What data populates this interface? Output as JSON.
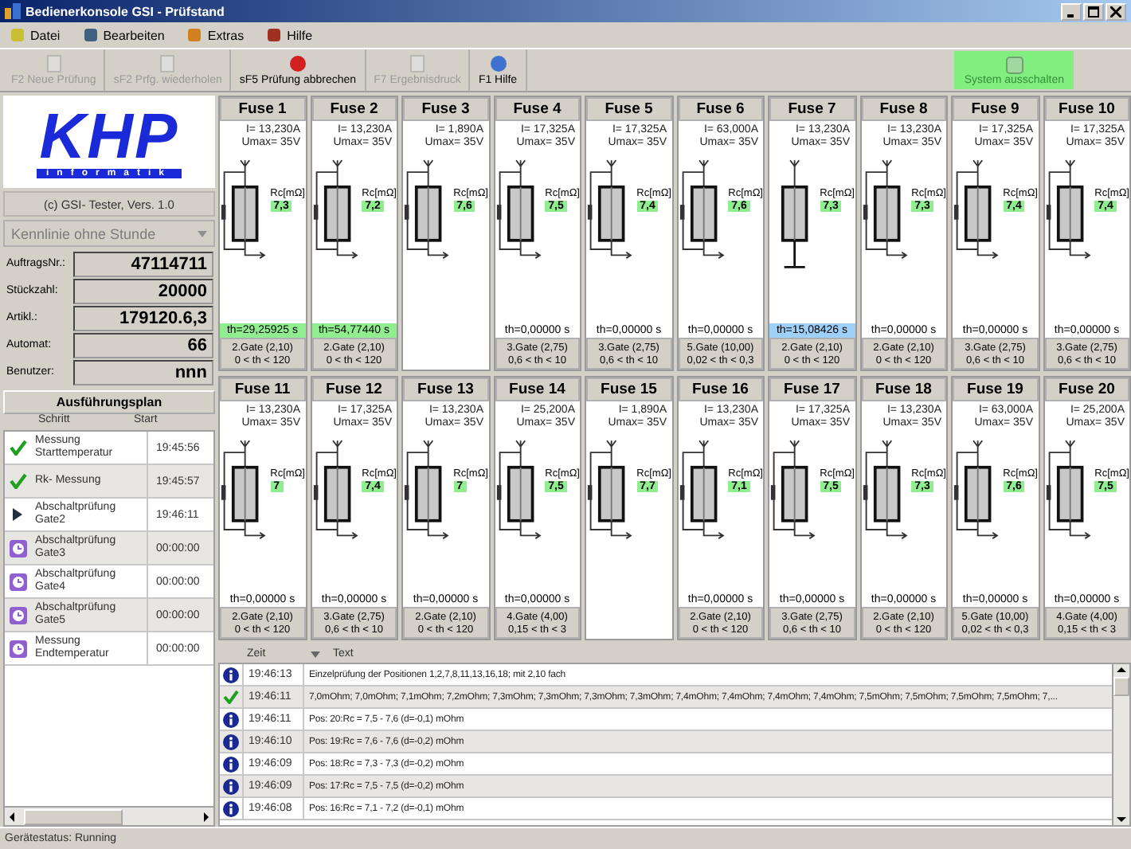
{
  "window": {
    "title": "Bedienerkonsole GSI - Prüfstand"
  },
  "menu": [
    {
      "label": "Datei"
    },
    {
      "label": "Bearbeiten"
    },
    {
      "label": "Extras"
    },
    {
      "label": "Hilfe"
    }
  ],
  "toolbar": [
    {
      "label": "F2 Neue Prüfung",
      "disabled": true
    },
    {
      "label": "sF2 Prfg. wiederholen",
      "disabled": true
    },
    {
      "label": "sF5 Prüfung abbrechen",
      "disabled": false
    },
    {
      "label": "F7 Ergebnisdruck",
      "disabled": true
    },
    {
      "label": "F1 Hilfe",
      "disabled": false
    }
  ],
  "power_button": {
    "label": "System ausschalten"
  },
  "logo": {
    "text": "KHP",
    "subtitle": "informatik"
  },
  "version": "(c) GSI- Tester, Vers. 1.0",
  "curve_select": {
    "value": "Kennlinie ohne Stunde",
    "disabled": true
  },
  "fields": [
    {
      "label": "AuftragsNr.:",
      "value": "47114711"
    },
    {
      "label": "Stückzahl:",
      "value": "20000"
    },
    {
      "label": "Artikl.:",
      "value": "179120.6,3"
    },
    {
      "label": "Automat:",
      "value": "66"
    },
    {
      "label": "Benutzer:",
      "value": "nnn"
    }
  ],
  "plan": {
    "title": "Ausführungsplan",
    "columns": [
      "Schritt",
      "Start"
    ],
    "steps": [
      {
        "kind": "done",
        "step": "Messung Starttemperatur",
        "start": "19:45:56"
      },
      {
        "kind": "done",
        "step": "Rk- Messung",
        "start": "19:45:57"
      },
      {
        "kind": "running",
        "step": "Abschaltprüfung Gate2",
        "start": "19:46:11"
      },
      {
        "kind": "pending",
        "step": "Abschaltprüfung Gate3",
        "start": "00:00:00"
      },
      {
        "kind": "pending",
        "step": "Abschaltprüfung Gate4",
        "start": "00:00:00"
      },
      {
        "kind": "pending",
        "step": "Abschaltprüfung Gate5",
        "start": "00:00:00"
      },
      {
        "kind": "pending",
        "step": "Messung Endtemperatur",
        "start": "00:00:00"
      }
    ]
  },
  "fuses": [
    {
      "name": "Fuse 1",
      "current": "I= 13,230A",
      "umax": "Umax= 35V",
      "kind": "bypass",
      "rc_label": "Rc[mΩ]",
      "rc": "7,3",
      "th": "th=29,25925 s",
      "passed": true,
      "running": false,
      "gate": [
        "2.Gate (2,10)",
        "0 < th < 120"
      ]
    },
    {
      "name": "Fuse 2",
      "current": "I= 13,230A",
      "umax": "Umax= 35V",
      "kind": "bypass",
      "rc_label": "Rc[mΩ]",
      "rc": "7,2",
      "th": "th=54,77440 s",
      "passed": true,
      "running": false,
      "gate": [
        "2.Gate (2,10)",
        "0 < th < 120"
      ]
    },
    {
      "name": "Fuse 3",
      "current": "I= 1,890A",
      "umax": "Umax= 35V",
      "kind": "bypass",
      "rc_label": "Rc[mΩ]",
      "rc": "7,6"
    },
    {
      "name": "Fuse 4",
      "current": "I= 17,325A",
      "umax": "Umax= 35V",
      "kind": "bypass",
      "rc_label": "Rc[mΩ]",
      "rc": "7,5",
      "th": "th=0,00000 s",
      "passed": false,
      "running": false,
      "gate": [
        "3.Gate (2,75)",
        "0,6 < th < 10"
      ]
    },
    {
      "name": "Fuse 5",
      "current": "I= 17,325A",
      "umax": "Umax= 35V",
      "kind": "bypass",
      "rc_label": "Rc[mΩ]",
      "rc": "7,4",
      "th": "th=0,00000 s",
      "passed": false,
      "running": false,
      "gate": [
        "3.Gate (2,75)",
        "0,6 < th < 10"
      ]
    },
    {
      "name": "Fuse 6",
      "current": "I= 63,000A",
      "umax": "Umax= 35V",
      "kind": "bypass",
      "rc_label": "Rc[mΩ]",
      "rc": "7,6",
      "th": "th=0,00000 s",
      "passed": false,
      "running": false,
      "gate": [
        "5.Gate (10,00)",
        "0,02 < th < 0,3"
      ]
    },
    {
      "name": "Fuse 7",
      "current": "I= 13,230A",
      "umax": "Umax= 35V",
      "kind": "ground",
      "rc_label": "Rc[mΩ]",
      "rc": "7,3",
      "th": "th=15,08426 s",
      "passed": false,
      "running": true,
      "gate": [
        "2.Gate (2,10)",
        "0 < th < 120"
      ]
    },
    {
      "name": "Fuse 8",
      "current": "I= 13,230A",
      "umax": "Umax= 35V",
      "kind": "bypass",
      "rc_label": "Rc[mΩ]",
      "rc": "7,3",
      "th": "th=0,00000 s",
      "passed": false,
      "running": false,
      "gate": [
        "2.Gate (2,10)",
        "0 < th < 120"
      ]
    },
    {
      "name": "Fuse 9",
      "current": "I= 17,325A",
      "umax": "Umax= 35V",
      "kind": "bypass",
      "rc_label": "Rc[mΩ]",
      "rc": "7,4",
      "th": "th=0,00000 s",
      "passed": false,
      "running": false,
      "gate": [
        "3.Gate (2,75)",
        "0,6 < th < 10"
      ]
    },
    {
      "name": "Fuse 10",
      "current": "I= 17,325A",
      "umax": "Umax= 35V",
      "kind": "bypass",
      "rc_label": "Rc[mΩ]",
      "rc": "7,4",
      "th": "th=0,00000 s",
      "passed": false,
      "running": false,
      "gate": [
        "3.Gate (2,75)",
        "0,6 < th < 10"
      ]
    },
    {
      "name": "Fuse 11",
      "current": "I= 13,230A",
      "umax": "Umax= 35V",
      "kind": "bypass",
      "rc_label": "Rc[mΩ]",
      "rc": "7",
      "th": "th=0,00000 s",
      "passed": false,
      "running": false,
      "gate": [
        "2.Gate (2,10)",
        "0 < th < 120"
      ]
    },
    {
      "name": "Fuse 12",
      "current": "I= 17,325A",
      "umax": "Umax= 35V",
      "kind": "bypass",
      "rc_label": "Rc[mΩ]",
      "rc": "7,4",
      "th": "th=0,00000 s",
      "passed": false,
      "running": false,
      "gate": [
        "3.Gate (2,75)",
        "0,6 < th < 10"
      ]
    },
    {
      "name": "Fuse 13",
      "current": "I= 13,230A",
      "umax": "Umax= 35V",
      "kind": "bypass",
      "rc_label": "Rc[mΩ]",
      "rc": "7",
      "th": "th=0,00000 s",
      "passed": false,
      "running": false,
      "gate": [
        "2.Gate (2,10)",
        "0 < th < 120"
      ]
    },
    {
      "name": "Fuse 14",
      "current": "I= 25,200A",
      "umax": "Umax= 35V",
      "kind": "bypass",
      "rc_label": "Rc[mΩ]",
      "rc": "7,5",
      "th": "th=0,00000 s",
      "passed": false,
      "running": false,
      "gate": [
        "4.Gate (4,00)",
        "0,15 < th < 3"
      ]
    },
    {
      "name": "Fuse 15",
      "current": "I= 1,890A",
      "umax": "Umax= 35V",
      "kind": "bypass",
      "rc_label": "Rc[mΩ]",
      "rc": "7,7"
    },
    {
      "name": "Fuse 16",
      "current": "I= 13,230A",
      "umax": "Umax= 35V",
      "kind": "bypass",
      "rc_label": "Rc[mΩ]",
      "rc": "7,1",
      "th": "th=0,00000 s",
      "passed": false,
      "running": false,
      "gate": [
        "2.Gate (2,10)",
        "0 < th < 120"
      ]
    },
    {
      "name": "Fuse 17",
      "current": "I= 17,325A",
      "umax": "Umax= 35V",
      "kind": "bypass",
      "rc_label": "Rc[mΩ]",
      "rc": "7,5",
      "th": "th=0,00000 s",
      "passed": false,
      "running": false,
      "gate": [
        "3.Gate (2,75)",
        "0,6 < th < 10"
      ]
    },
    {
      "name": "Fuse 18",
      "current": "I= 13,230A",
      "umax": "Umax= 35V",
      "kind": "bypass",
      "rc_label": "Rc[mΩ]",
      "rc": "7,3",
      "th": "th=0,00000 s",
      "passed": false,
      "running": false,
      "gate": [
        "2.Gate (2,10)",
        "0 < th < 120"
      ]
    },
    {
      "name": "Fuse 19",
      "current": "I= 63,000A",
      "umax": "Umax= 35V",
      "kind": "bypass",
      "rc_label": "Rc[mΩ]",
      "rc": "7,6",
      "th": "th=0,00000 s",
      "passed": false,
      "running": false,
      "gate": [
        "5.Gate (10,00)",
        "0,02 < th < 0,3"
      ]
    },
    {
      "name": "Fuse 20",
      "current": "I= 25,200A",
      "umax": "Umax= 35V",
      "kind": "bypass",
      "rc_label": "Rc[mΩ]",
      "rc": "7,5",
      "th": "th=0,00000 s",
      "passed": false,
      "running": false,
      "gate": [
        "4.Gate (4,00)",
        "0,15 < th < 3"
      ]
    }
  ],
  "log": {
    "columns": [
      "Zeit",
      "Text"
    ],
    "rows": [
      {
        "kind": "info",
        "time": "19:46:13",
        "text": "Einzelprüfung der Positionen 1,2,7,8,11,13,16,18; mit 2,10 fach"
      },
      {
        "kind": "ok",
        "time": "19:46:11",
        "text": "7,0mOhm; 7,0mOhm; 7,1mOhm; 7,2mOhm; 7,3mOhm; 7,3mOhm; 7,3mOhm; 7,3mOhm; 7,4mOhm; 7,4mOhm; 7,4mOhm; 7,4mOhm; 7,5mOhm; 7,5mOhm; 7,5mOhm; 7,5mOhm; 7,..."
      },
      {
        "kind": "info",
        "time": "19:46:11",
        "text": "Pos: 20:Rc = 7,5 - 7,6 (d=-0,1) mOhm"
      },
      {
        "kind": "info",
        "time": "19:46:10",
        "text": "Pos: 19:Rc = 7,6 - 7,6 (d=-0,2) mOhm"
      },
      {
        "kind": "info",
        "time": "19:46:09",
        "text": "Pos: 18:Rc = 7,3 - 7,3 (d=-0,2) mOhm"
      },
      {
        "kind": "info",
        "time": "19:46:09",
        "text": "Pos: 17:Rc = 7,5 - 7,5 (d=-0,2) mOhm"
      },
      {
        "kind": "info",
        "time": "19:46:08",
        "text": "Pos: 16:Rc = 7,1 - 7,2 (d=-0,1) mOhm"
      }
    ]
  },
  "status_bar": "Gerätestatus: Running"
}
